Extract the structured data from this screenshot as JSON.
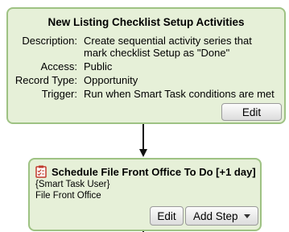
{
  "top_card": {
    "title": "New Listing Checklist Setup Activities",
    "rows": [
      {
        "label": "Description:",
        "value": "Create sequential activity series that mark checklist Setup as \"Done\""
      },
      {
        "label": "Access:",
        "value": "Public"
      },
      {
        "label": "Record Type:",
        "value": "Opportunity"
      },
      {
        "label": "Trigger:",
        "value": "Run when Smart Task conditions are met"
      }
    ],
    "edit_label": "Edit"
  },
  "step_card": {
    "icon": "checklist-icon",
    "title": "Schedule File Front Office To Do [+1 day]",
    "assignee": "{Smart Task User}",
    "task_name": "File Front Office",
    "edit_label": "Edit",
    "add_step_label": "Add Step"
  },
  "colors": {
    "card_fill": "#e6f0d8",
    "card_border": "#9ec283",
    "icon_red": "#c0392b"
  }
}
